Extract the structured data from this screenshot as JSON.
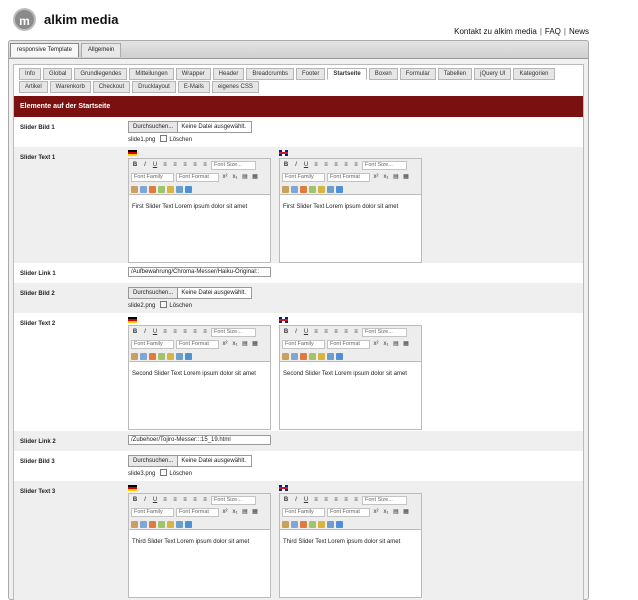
{
  "brand": {
    "logo_letter": "m",
    "name": "alkim media"
  },
  "topnav": {
    "links": [
      "Kontakt zu alkim media",
      "FAQ",
      "News"
    ]
  },
  "outer_tabs": [
    "responsive Template",
    "Allgemein"
  ],
  "inner_tabs_row1": [
    "Info",
    "Global",
    "Grundlegendes",
    "Mitteilungen",
    "Wrapper",
    "Header",
    "Breadcrumbs",
    "Footer",
    "Startseite",
    "Boxen",
    "Formular",
    "Tabellen",
    "jQuery UI",
    "Kategorien"
  ],
  "inner_tabs_row2": [
    "Artikel",
    "Warenkorb",
    "Checkout",
    "Drucklayout",
    "E-Mails",
    "eigenes CSS"
  ],
  "active_tab": "Startseite",
  "section_title": "Elemente auf der Startseite",
  "file_button": "Durchsuchen...",
  "file_none": "Keine Datei ausgewählt.",
  "delete_label": "Löschen",
  "toolbar": {
    "font_size": "Font Size...",
    "font_family": "Font Family",
    "font_format": "Font Format",
    "bold": "B",
    "italic": "I",
    "underline": "U",
    "superscript": "x²",
    "subscript": "x₁"
  },
  "rows": {
    "bild1": {
      "label": "Slider Bild 1",
      "file": "slide1.png"
    },
    "text1": {
      "label": "Slider Text 1",
      "de": "First Slider Text Lorem ipsum dolor sit amet",
      "en": "First Slider Text Lorem ipsum dolor sit amet"
    },
    "link1": {
      "label": "Slider Link 1",
      "value": "/Aufbewahrung/Chroma-Messer/Haiku-Original::"
    },
    "bild2": {
      "label": "Slider Bild 2",
      "file": "slide2.png"
    },
    "text2": {
      "label": "Slider Text 2",
      "de": "Second Slider Text Lorem ipsum dolor sit amet",
      "en": "Second Slider Text Lorem ipsum dolor sit amet"
    },
    "link2": {
      "label": "Slider Link 2",
      "value": "/Zubehoer/Tojiro-Messer:::15_19.html"
    },
    "bild3": {
      "label": "Slider Bild 3",
      "file": "slide3.png"
    },
    "text3": {
      "label": "Slider Text 3",
      "de": "Third Slider Text Lorem ipsum dolor sit amet",
      "en": "Third Slider Text Lorem ipsum dolor sit amet"
    }
  },
  "colors": {
    "section_head": "#7a1010",
    "row_alt": "#efefef"
  }
}
